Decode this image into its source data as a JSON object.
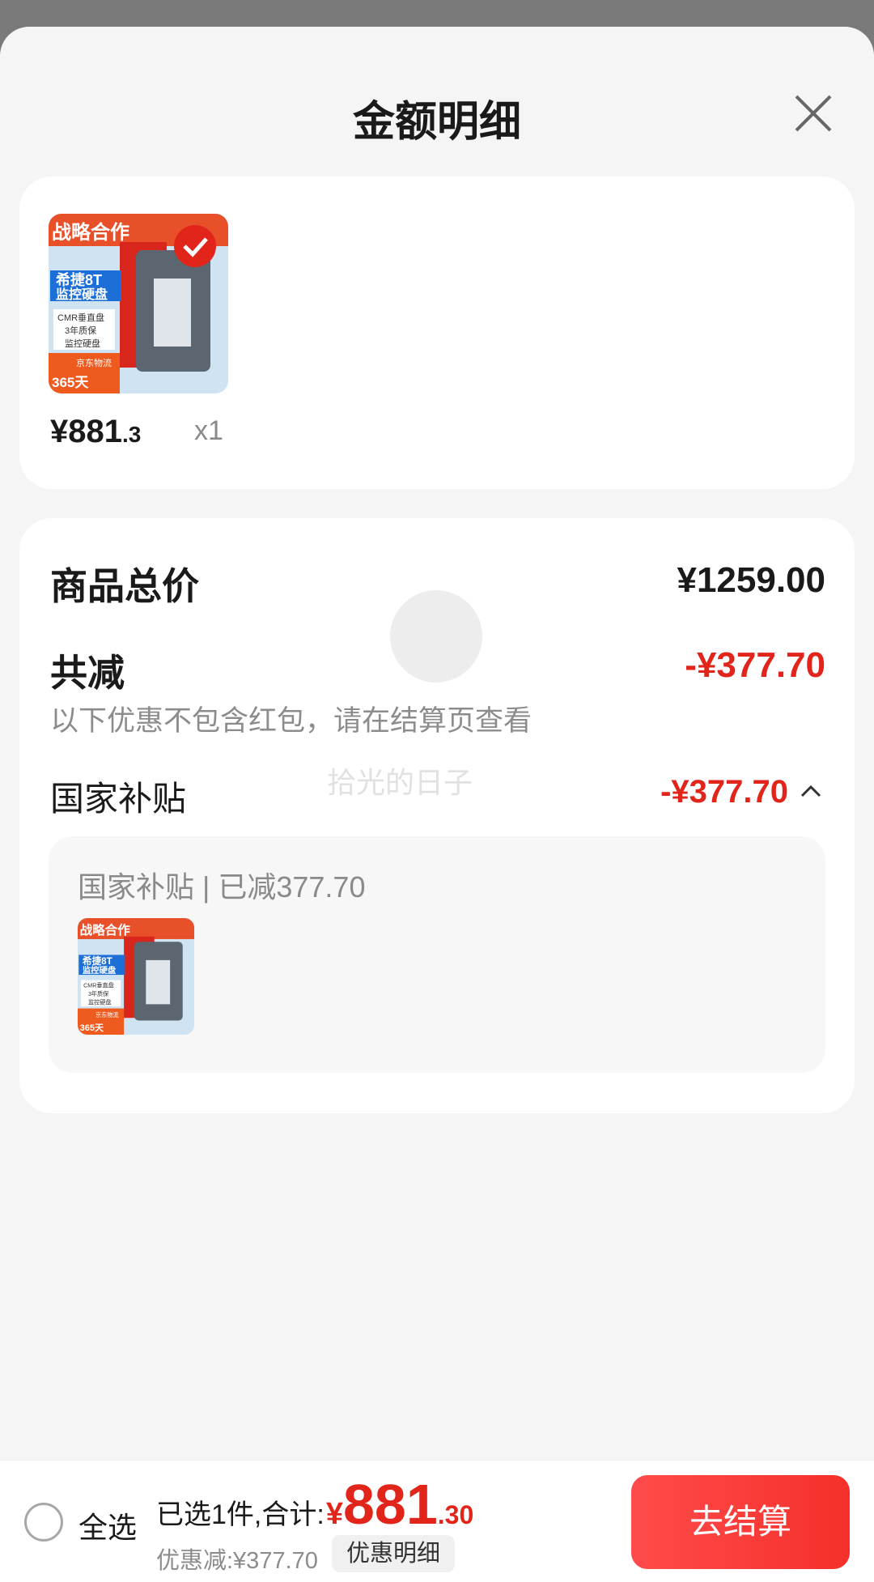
{
  "sheet": {
    "title": "金额明细"
  },
  "product": {
    "price_int": "¥881",
    "price_dec": ".3",
    "quantity": "x1",
    "image_text": {
      "ribbon": "战略合作",
      "name1": "希捷8T",
      "name2": "监控硬盘",
      "f1": "CMR垂直盘",
      "f2": "3年质保",
      "f3": "监控硬盘",
      "badge": "365天",
      "logistics": "京东物流"
    }
  },
  "summary": {
    "total_label": "商品总价",
    "total_value": "¥1259.00",
    "reduce_label": "共减",
    "reduce_value": "-¥377.70",
    "note": "以下优惠不包含红包，请在结算页查看",
    "subsidy_label": "国家补贴",
    "subsidy_value": "-¥377.70",
    "detail_title": "国家补贴 | 已减377.70"
  },
  "watermark": "拾光的日子",
  "footer": {
    "select_all": "全选",
    "total_prefix": "已选1件,合计:",
    "currency": "¥",
    "total_int": "881",
    "total_dec": ".30",
    "discount": "优惠减:¥377.70",
    "discount_detail": "优惠明细",
    "checkout": "去结算"
  },
  "colors": {
    "accent": "#e1251b",
    "checkout_button": "#f5302a",
    "background": "#f5f5f5"
  },
  "icons": [
    "close-icon",
    "check-badge-icon",
    "chevron-up-icon",
    "radio-icon"
  ]
}
